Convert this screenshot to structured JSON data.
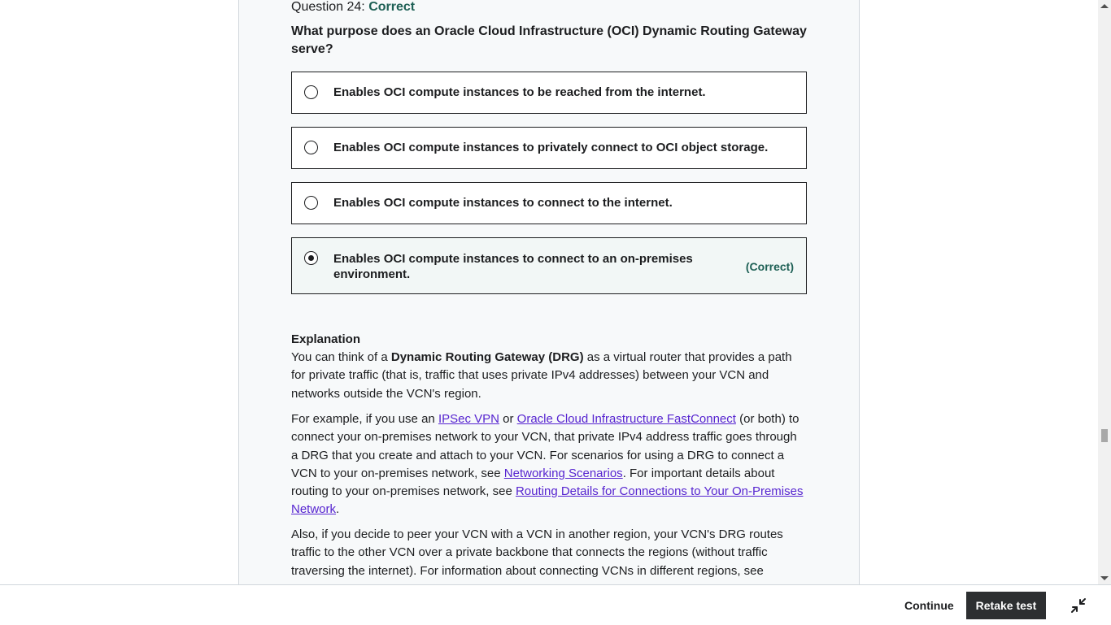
{
  "question": {
    "label": "Question 24:",
    "status": "Correct",
    "text": "What purpose does an Oracle Cloud Infrastructure (OCI) Dynamic Routing Gateway serve?"
  },
  "options": [
    {
      "label": "Enables OCI compute instances to be reached from the internet.",
      "selected": false
    },
    {
      "label": "Enables OCI compute instances to privately connect to OCI object storage.",
      "selected": false
    },
    {
      "label": "Enables OCI compute instances to connect to the internet.",
      "selected": false
    },
    {
      "label": "Enables OCI compute instances to connect to an on-premises environment.",
      "selected": true,
      "tag": "(Correct)"
    }
  ],
  "explanation": {
    "title": "Explanation",
    "p1": {
      "t1": "You can think of a ",
      "bold": "Dynamic Routing Gateway (DRG)",
      "t2": " as a virtual router that provides a path for private traffic (that is, traffic that uses private IPv4 addresses) between your VCN and networks outside the VCN's region."
    },
    "p2": {
      "t1": "For example, if you use an ",
      "link1": "IPSec VPN",
      "t2": " or ",
      "link2": "Oracle Cloud Infrastructure FastConnect",
      "t3": " (or both) to connect your on-premises network to your VCN, that private IPv4 address traffic goes through a DRG that you create and attach to your VCN. For scenarios for using a DRG to connect a VCN to your on-premises network, see ",
      "link3": "Networking Scenarios",
      "t4": ". For important details about routing to your on-premises network, see ",
      "link4": "Routing Details for Connections to Your On-Premises Network",
      "t5": "."
    },
    "p3": {
      "t1": "Also, if you decide to peer your VCN with a VCN in another region, your VCN's DRG routes traffic to the other VCN over a private backbone that connects the regions (without traffic traversing the internet). For information about connecting VCNs in different regions, see"
    }
  },
  "footer": {
    "continue_label": "Continue",
    "retake_label": "Retake test",
    "collapse_icon": "collapse-icon"
  },
  "colors": {
    "correct": "#1e6055",
    "link": "#5624d0",
    "primary_button": "#2d2f31"
  }
}
